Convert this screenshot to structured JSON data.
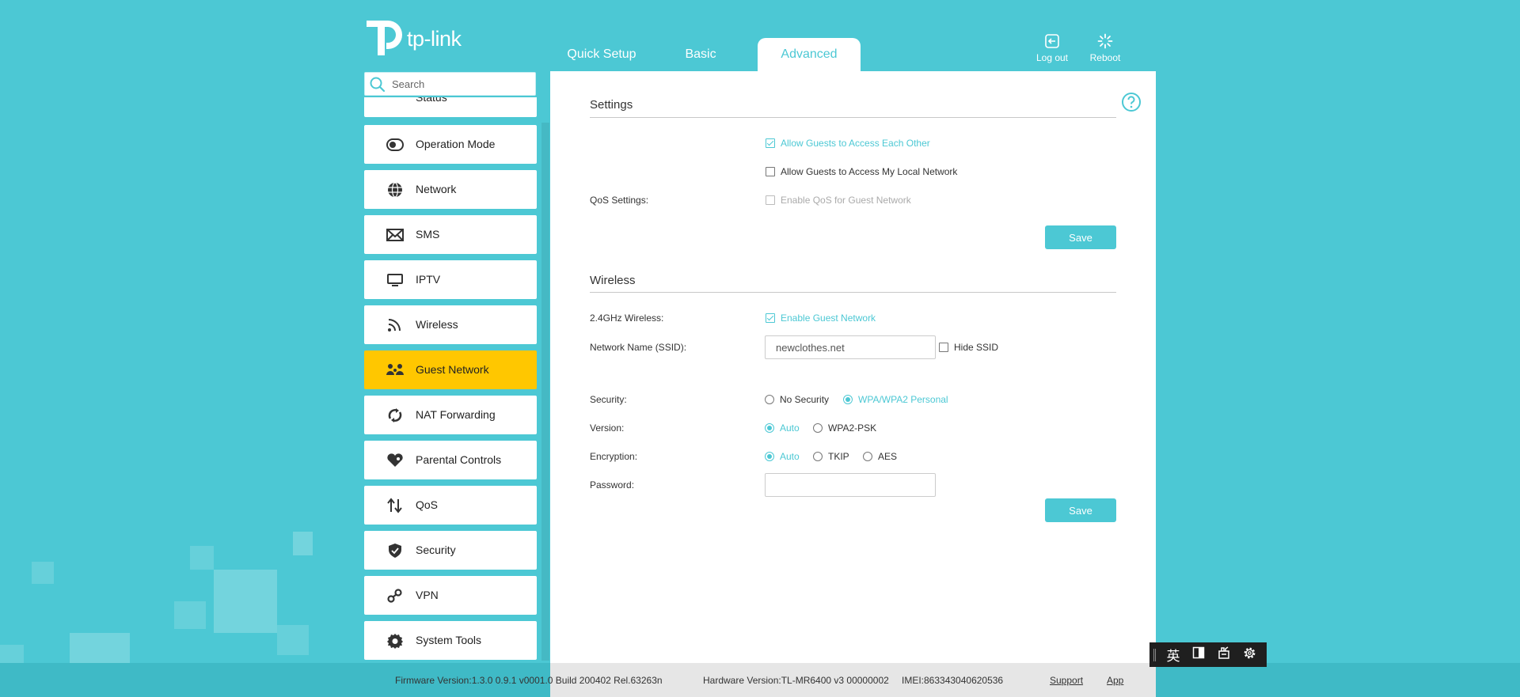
{
  "brand": {
    "name": "tp-link"
  },
  "tabs": [
    {
      "label": "Quick Setup"
    },
    {
      "label": "Basic"
    },
    {
      "label": "Advanced",
      "active": true
    }
  ],
  "topbar": {
    "logout_label": "Log out",
    "reboot_label": "Reboot"
  },
  "search": {
    "placeholder": "Search"
  },
  "sidebar": {
    "items": [
      {
        "label": "Status",
        "icon": "status-icon"
      },
      {
        "label": "Operation Mode",
        "icon": "toggle-icon"
      },
      {
        "label": "Network",
        "icon": "globe-icon"
      },
      {
        "label": "SMS",
        "icon": "envelope-icon"
      },
      {
        "label": "IPTV",
        "icon": "monitor-icon"
      },
      {
        "label": "Wireless",
        "icon": "wifi-icon"
      },
      {
        "label": "Guest Network",
        "icon": "guests-icon",
        "active": true
      },
      {
        "label": "NAT Forwarding",
        "icon": "forwarding-icon"
      },
      {
        "label": "Parental Controls",
        "icon": "heart-icon"
      },
      {
        "label": "QoS",
        "icon": "updown-arrows-icon"
      },
      {
        "label": "Security",
        "icon": "shield-icon"
      },
      {
        "label": "VPN",
        "icon": "link-icon"
      },
      {
        "label": "System Tools",
        "icon": "gear-icon"
      }
    ]
  },
  "settings": {
    "title": "Settings",
    "allow_each_other": {
      "label": "Allow Guests to Access Each Other",
      "checked": true
    },
    "allow_local": {
      "label": "Allow Guests to Access My Local Network",
      "checked": false
    },
    "qos_label": "QoS Settings:",
    "qos": {
      "label": "Enable QoS for Guest Network",
      "checked": false,
      "disabled": true
    },
    "save_label": "Save"
  },
  "wireless": {
    "title": "Wireless",
    "band_label": "2.4GHz Wireless:",
    "enable": {
      "label": "Enable Guest Network",
      "checked": true
    },
    "ssid_label": "Network Name (SSID):",
    "ssid_value": "newclothes.net",
    "hide_ssid": {
      "label": "Hide SSID",
      "checked": false
    },
    "security_label": "Security:",
    "security_options": [
      "No Security",
      "WPA/WPA2 Personal"
    ],
    "security_selected": "WPA/WPA2 Personal",
    "version_label": "Version:",
    "version_options": [
      "Auto",
      "WPA2-PSK"
    ],
    "version_selected": "Auto",
    "encryption_label": "Encryption:",
    "encryption_options": [
      "Auto",
      "TKIP",
      "AES"
    ],
    "encryption_selected": "Auto",
    "password_label": "Password:",
    "password_value": "",
    "save_label": "Save"
  },
  "footer": {
    "firmware": "Firmware Version:1.3.0 0.9.1 v0001.0 Build 200402 Rel.63263n",
    "hardware": "Hardware Version:TL-MR6400 v3 00000002",
    "imei": "IMEI:863343040620536",
    "support_label": "Support",
    "app_label": "App"
  },
  "ime_toolbar": {
    "lang_label": "英"
  },
  "colors": {
    "accent": "#4cc8d4",
    "active_menu": "#ffc700"
  }
}
